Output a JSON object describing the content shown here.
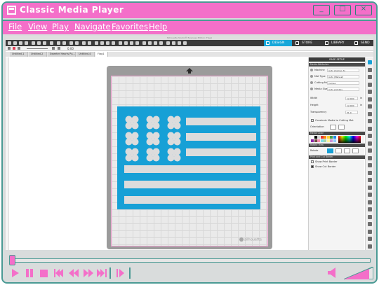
{
  "player": {
    "title": "Classic Media Player",
    "window_buttons": [
      "_",
      "□",
      "×"
    ],
    "menu": [
      "File",
      "View",
      "Play",
      "Navigate",
      "Favorites",
      "Help"
    ],
    "progress_fraction": 0.01,
    "controls": [
      "play-icon",
      "pause-icon",
      "stop-icon",
      "rewind-start-icon",
      "rewind-icon",
      "fast-forward-icon",
      "skip-end-icon",
      "step-icon",
      "volume-icon",
      "volume-slider"
    ],
    "accent_color": "#f46fc9",
    "border_color": "#4a9a94"
  },
  "app": {
    "window_title": "Silhouette Studio® Business Edition: Flag1",
    "top_tabs": [
      "DESIGN",
      "STORE",
      "LIBRARY",
      "SEND"
    ],
    "zoom_value": "0.00",
    "doc_tabs": [
      "Untitled-1",
      "Untitled-2",
      "Sweeter Hearts Pu...",
      "Untitled-4",
      "Flag1"
    ],
    "mat_brand": "silhouette",
    "flag_color": "#17a0d6",
    "panel": {
      "header": "PAGE SETUP",
      "section_media": "Media Attributes",
      "rows": [
        {
          "label": "Machine",
          "value": "Auto (Cameo 3)"
        },
        {
          "label": "Mat Type",
          "value": "Auto (Manual)"
        },
        {
          "label": "Cutting Mat",
          "value": "Cameo"
        },
        {
          "label": "Media Size",
          "value": "Auto (12x12)"
        }
      ],
      "width_label": "Width",
      "width_value": "12.000",
      "height_label": "Height",
      "height_value": "12.000",
      "transparency_label": "Transparency",
      "transparency_value": "31.0",
      "unit": "in",
      "constrain_label": "Constrain Media to Cutting Mat",
      "orientation_label": "Orientation",
      "section_color": "Media Color",
      "section_view": "Rotate View",
      "rotate_label": "Rotate",
      "section_print": "Print and Cut Border",
      "show_print_border": "Show Print Border",
      "show_cut_border": "Show Cut Border"
    }
  }
}
